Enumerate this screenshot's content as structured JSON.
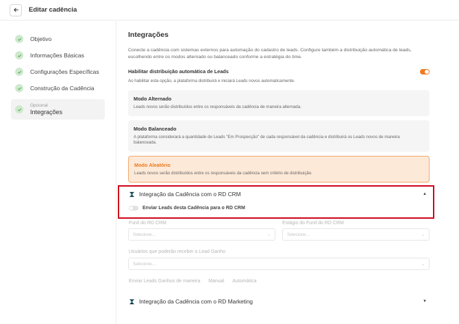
{
  "header": {
    "title": "Editar cadência"
  },
  "sidebar": {
    "steps": [
      {
        "label": "Objetivo"
      },
      {
        "label": "Informações Básicas"
      },
      {
        "label": "Configurações Específicas"
      },
      {
        "label": "Construção da Cadência"
      }
    ],
    "active": {
      "optional_label": "Opcional",
      "label": "Integrações"
    }
  },
  "main": {
    "title": "Integrações",
    "description": "Conecte a cadência com sistemas externos para automação do cadastro de leads. Configure também a distribuição automática de leads, escolhendo entre os modos alternado ou balanceado conforme a estratégia do time.",
    "distribution": {
      "title": "Habilitar distribuição automática de Leads",
      "description": "Ao habilitar esta opção, a plataforma distribuirá e iniciará Leads novos automaticamente.",
      "enabled": true
    },
    "modes": [
      {
        "title": "Modo Alternado",
        "description": "Leads novos serão distribuídos entre os responsáveis da cadência de maneira alternada."
      },
      {
        "title": "Modo Balanceado",
        "description": "A plataforma considerará a quantidade de Leads \"Em Prospecção\" de cada responsável da cadência e distribuirá os Leads novos de maneira balanceada."
      },
      {
        "title": "Modo Aleatório",
        "description": "Leads novos serão distribuídos entre os responsáveis da cadência sem critério de distribuição."
      }
    ],
    "crm": {
      "title": "Integração da Cadência com o RD CRM",
      "toggle_label": "Enviar Leads desta Cadência para o RD CRM",
      "funnel_label": "Funil do RD CRM",
      "funnel_placeholder": "Selecione...",
      "stage_label": "Estágio do Funil do RD CRM",
      "stage_placeholder": "Selecione...",
      "users_label": "Usuários que poderão receber o Lead Ganho",
      "users_placeholder": "Selecione...",
      "send_mode_label": "Enviar Leads Ganhos de maneira",
      "send_mode_options": [
        "Manual",
        "Automática"
      ]
    },
    "marketing": {
      "title": "Integração da Cadência com o RD Marketing"
    }
  },
  "colors": {
    "accent": "#f07c22",
    "highlight": "#d0021b",
    "check": "#5aa85a"
  }
}
